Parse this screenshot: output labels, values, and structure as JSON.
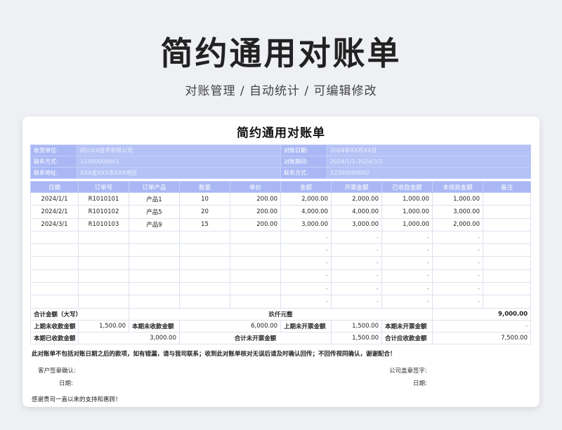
{
  "hero": {
    "title": "简约通用对账单",
    "subtitle": "对账管理 / 自动统计 / 可编辑修改"
  },
  "sheet": {
    "title": "简约通用对账单",
    "info": [
      {
        "l1": "收货单位:",
        "v1": "四川XX技术有限公司",
        "l2": "对账日期:",
        "v2": "2024年XX月XX日"
      },
      {
        "l1": "联系方式:",
        "v1": "12300000001",
        "l2": "对账期间:",
        "v2": "2024/1/1-2024/3/2"
      },
      {
        "l1": "联系地址:",
        "v1": "XXX省XXX市XXX地区",
        "l2": "联系方式:",
        "v2": "12300000002"
      }
    ],
    "headers": [
      "日期",
      "订单号",
      "订单产品",
      "数量",
      "单价",
      "金额",
      "开票金额",
      "已收款金额",
      "未收款金额",
      "备注"
    ],
    "rows": [
      [
        "2024/1/1",
        "R1010101",
        "产品1",
        "10",
        "200.00",
        "2,000.00",
        "2,000.00",
        "1,000.00",
        "1,000.00",
        ""
      ],
      [
        "2024/2/1",
        "R1010102",
        "产品5",
        "20",
        "200.00",
        "4,000.00",
        "4,000.00",
        "1,000.00",
        "3,000.00",
        ""
      ],
      [
        "2024/3/1",
        "R1010103",
        "产品9",
        "15",
        "200.00",
        "3,000.00",
        "3,000.00",
        "1,000.00",
        "2,000.00",
        ""
      ],
      [
        "",
        "",
        "",
        "",
        "",
        "-",
        "-",
        "-",
        "-",
        ""
      ],
      [
        "",
        "",
        "",
        "",
        "",
        "-",
        "-",
        "-",
        "-",
        ""
      ],
      [
        "",
        "",
        "",
        "",
        "",
        "-",
        "-",
        "-",
        "-",
        ""
      ],
      [
        "",
        "",
        "",
        "",
        "",
        "-",
        "-",
        "-",
        "-",
        ""
      ],
      [
        "",
        "",
        "",
        "",
        "",
        "-",
        "-",
        "-",
        "-",
        ""
      ],
      [
        "",
        "",
        "",
        "",
        "",
        "-",
        "-",
        "-",
        "-",
        ""
      ]
    ],
    "total_label": "合计金额（大写）",
    "total_words": "玖仟元整",
    "total_value": "9,000.00",
    "sum1": {
      "l1": "上期未收款金额",
      "v1": "1,500.00",
      "l2": "本期未收款金额",
      "v2": "6,000.00",
      "l3": "上期未开票金额",
      "v3": "1,500.00",
      "l4": "本期未开票金额",
      "v4": "-"
    },
    "sum2": {
      "l1": "本期已收款金额",
      "v1": "3,000.00",
      "l2": "合计未开票金额",
      "v2": "1,500.00",
      "l3": "合计应收款金额",
      "v3": "7,500.00"
    },
    "notice": "此对账单不包括对账日期之后的款项，如有错漏，请与我司联系；收到此对账单核对无误后请及时确认回传；不回传视同确认，谢谢配合！",
    "customer_sign": "客户签章确认:",
    "company_sign": "公司盖章签字:",
    "date_label": "日期:",
    "thanks": "感谢贵司一直以来的支持和惠顾！"
  }
}
